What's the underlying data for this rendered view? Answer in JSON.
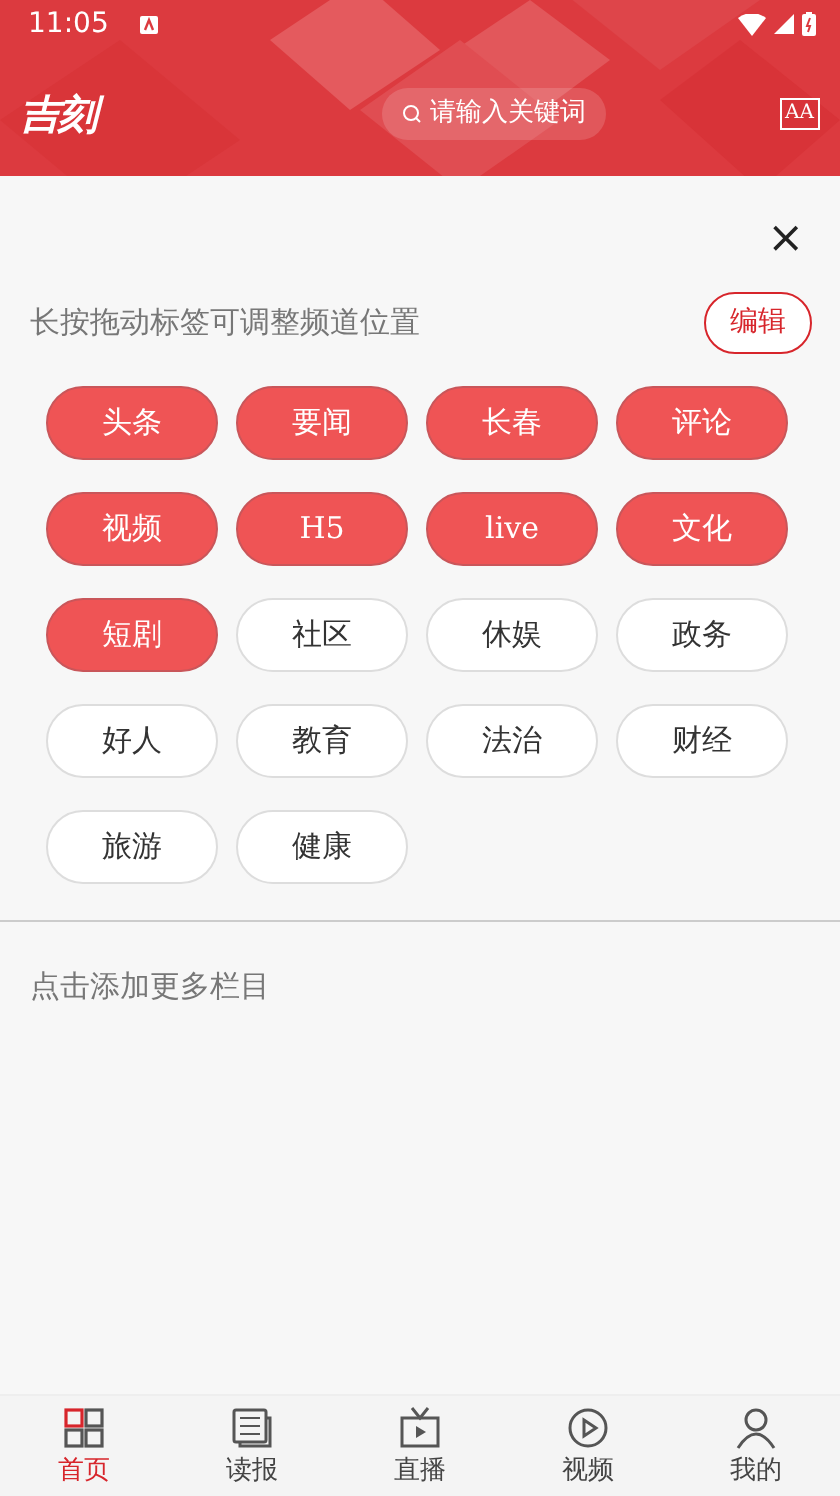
{
  "status_bar": {
    "time": "11:05"
  },
  "header": {
    "logo": "吉刻",
    "search": {
      "placeholder": "请输入关键词"
    },
    "font_button": "AA"
  },
  "close": "×",
  "hint": "长按拖动标签可调整频道位置",
  "edit_button": "编辑",
  "channels": [
    {
      "label": "头条",
      "selected": true
    },
    {
      "label": "要闻",
      "selected": true
    },
    {
      "label": "长春",
      "selected": true
    },
    {
      "label": "评论",
      "selected": true
    },
    {
      "label": "视频",
      "selected": true
    },
    {
      "label": "H5",
      "selected": true
    },
    {
      "label": "live",
      "selected": true
    },
    {
      "label": "文化",
      "selected": true
    },
    {
      "label": "短剧",
      "selected": true
    },
    {
      "label": "社区",
      "selected": false
    },
    {
      "label": "休娱",
      "selected": false
    },
    {
      "label": "政务",
      "selected": false
    },
    {
      "label": "好人",
      "selected": false
    },
    {
      "label": "教育",
      "selected": false
    },
    {
      "label": "法治",
      "selected": false
    },
    {
      "label": "财经",
      "selected": false
    },
    {
      "label": "旅游",
      "selected": false
    },
    {
      "label": "健康",
      "selected": false
    }
  ],
  "more_hint": "点击添加更多栏目",
  "tab_bar": [
    {
      "label": "首页",
      "kind": "home",
      "selected": true
    },
    {
      "label": "读报",
      "kind": "paper",
      "selected": false
    },
    {
      "label": "直播",
      "kind": "live",
      "selected": false
    },
    {
      "label": "视频",
      "kind": "video",
      "selected": false
    },
    {
      "label": "我的",
      "kind": "me",
      "selected": false
    }
  ]
}
